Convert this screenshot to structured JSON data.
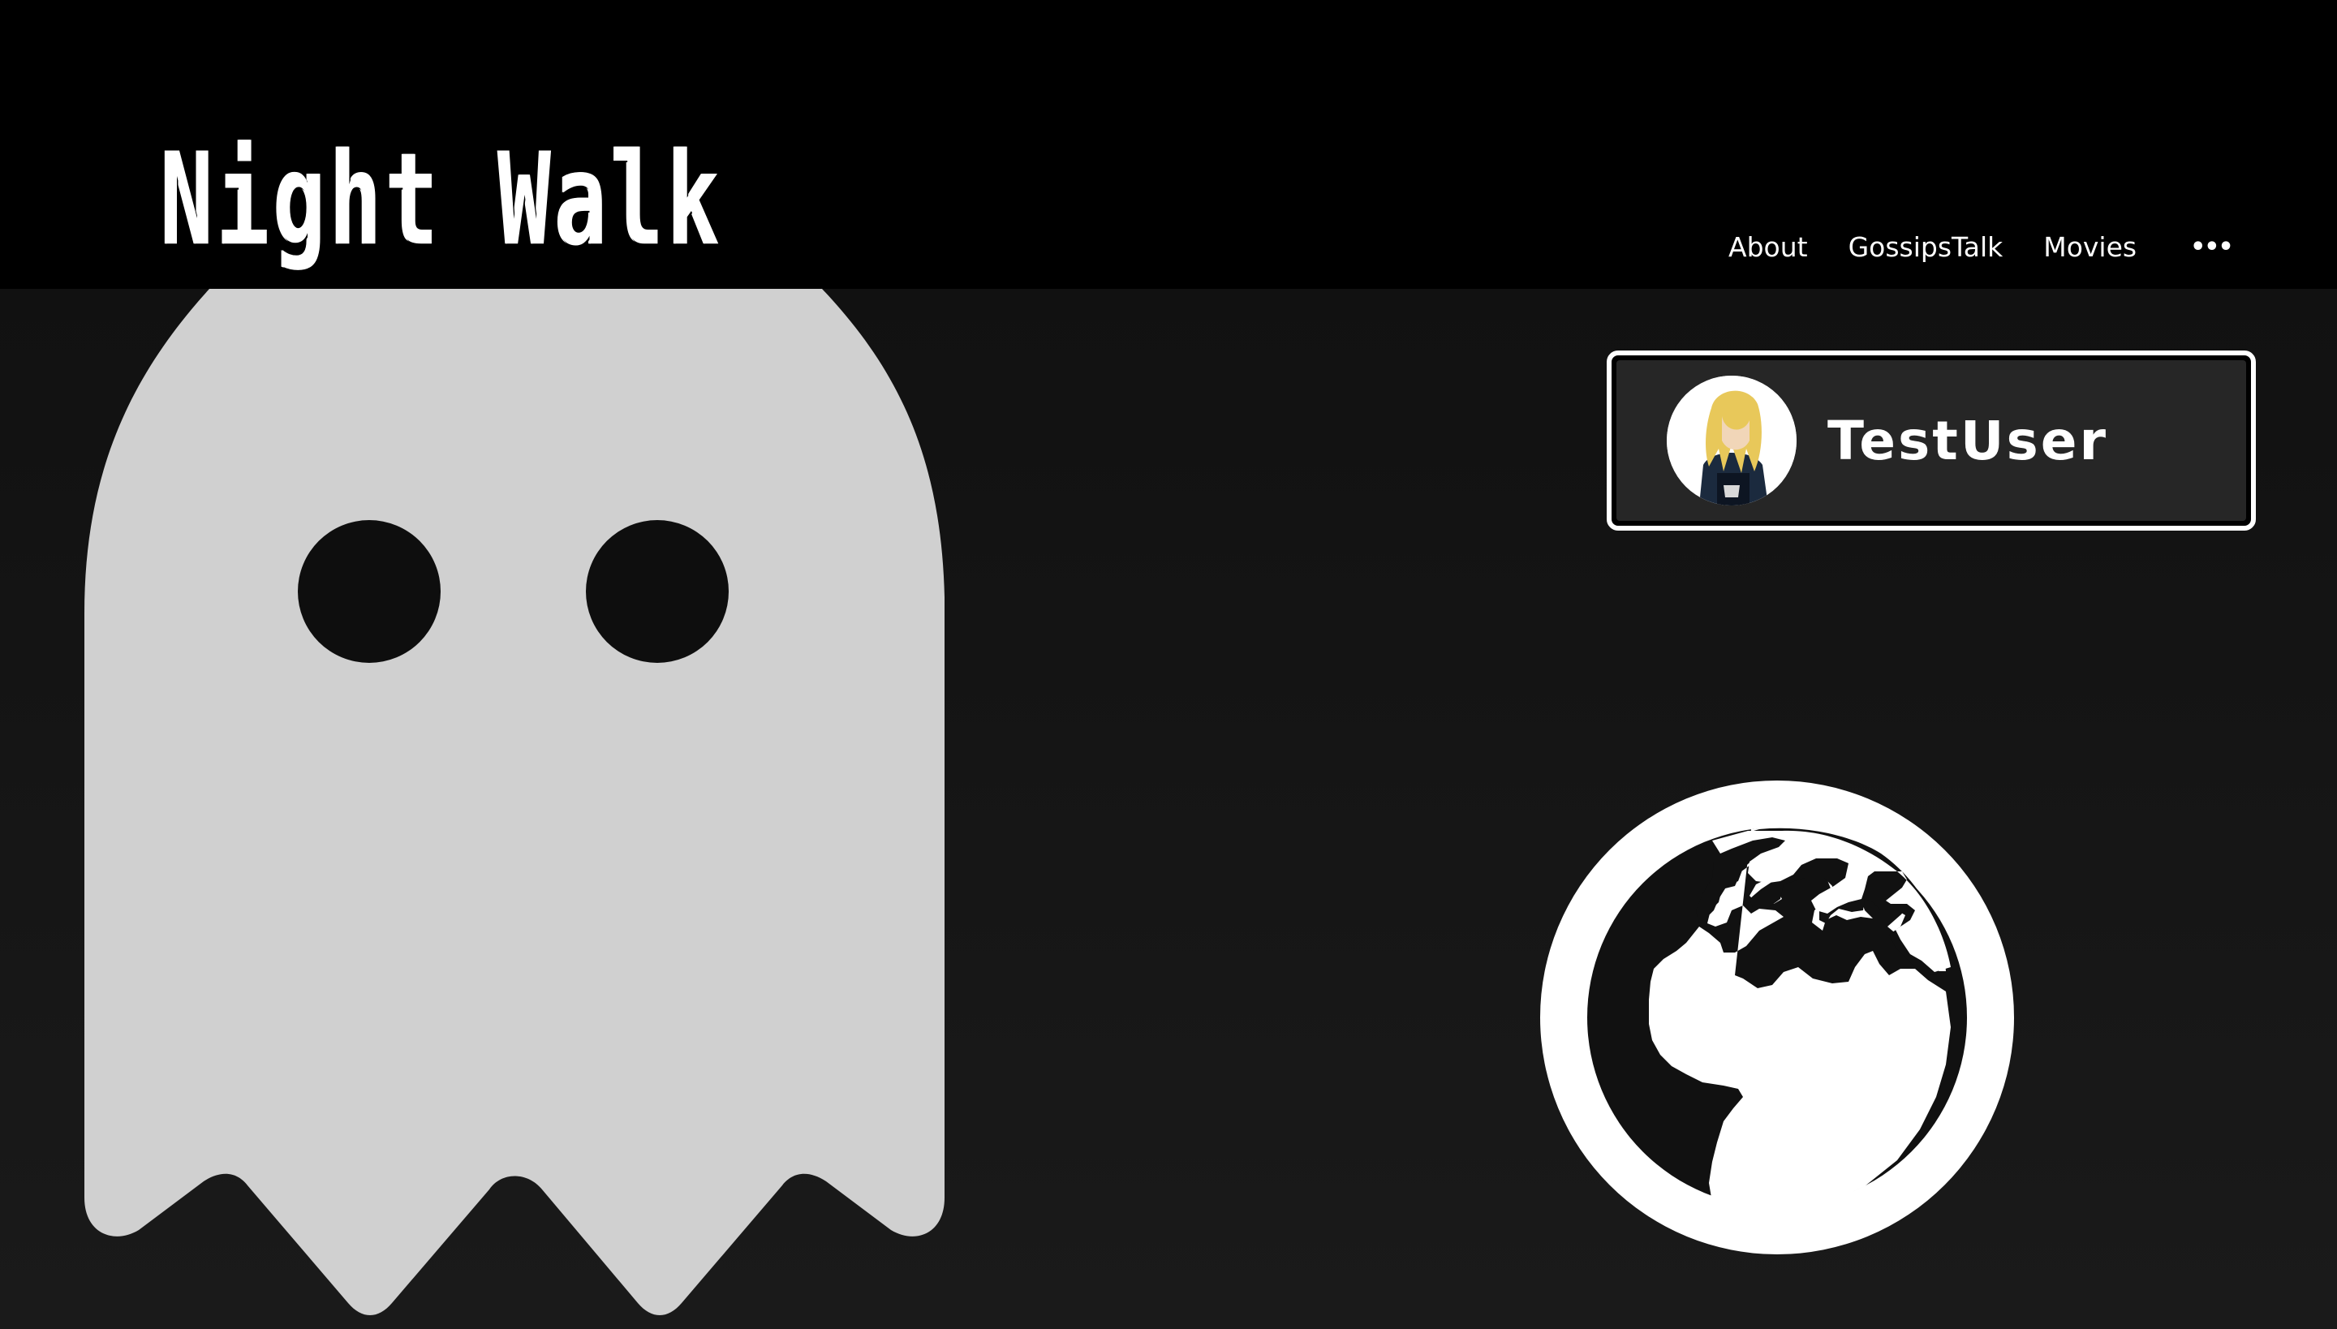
{
  "header": {
    "logo_text": "Night Walk",
    "nav": {
      "items": [
        {
          "label": "About"
        },
        {
          "label": "GossipsTalk"
        },
        {
          "label": "Movies"
        }
      ],
      "more_label": "•••"
    }
  },
  "main": {
    "ghost_icon": "ghost-icon",
    "user_card": {
      "username": "TestUser",
      "avatar_icon": "user-avatar"
    },
    "globe_icon": "globe-icon"
  },
  "colors": {
    "background": "#111111",
    "header": "#000000",
    "ghost": "#d0d0d0",
    "accent": "#ffffff",
    "card": "#262626"
  }
}
